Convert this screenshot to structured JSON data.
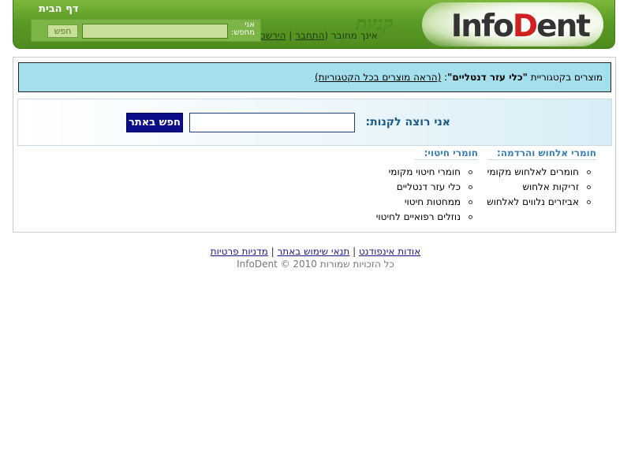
{
  "header": {
    "logo_prefix": "Info",
    "logo_red": "D",
    "logo_suffix": "ent",
    "logo_subtitle": "קניות",
    "home_link": "דף הבית",
    "status_text": "אינך מחובר",
    "login_link": "התחבר",
    "register_link": "הירשם",
    "search": {
      "label": "אני מחפש:",
      "value": "",
      "button": "חפש"
    }
  },
  "category_bar": {
    "prefix": "מוצרים בקטגוריית",
    "category_name": "\"כלי עזר דנטליים\"",
    "separator": ":",
    "all_link": "(הראה מוצרים בכל הקטגוריות)"
  },
  "want": {
    "label": "אני רוצה לקנות:",
    "value": "",
    "button": "חפש באתר"
  },
  "categories": [
    {
      "title": "חומרי אלחוש והרדמה:",
      "items": [
        "חומרים לאלחוש מקומי",
        "זריקות אלחוש",
        "אביזרים נלווים לאלחוש"
      ]
    },
    {
      "title": "חומרי חיטוי:",
      "items": [
        "חומרי חיטוי מקומי",
        "כלי עזר דנטליים",
        "ממחטות חיטוי",
        "נוזלים רפואיים לחיטוי"
      ]
    }
  ],
  "footer": {
    "links": [
      "אודות אינפודנט",
      "תנאי שימוש באתר",
      "מדניות פרטיות"
    ],
    "separator": "|",
    "copyright": "כל הזכויות שמורות InfoDent © 2010"
  },
  "colors": {
    "header_green": "#5a9a26",
    "category_bar_bg": "#a6dfec",
    "search_button_bg": "#0d0d8a",
    "category_title": "#3b7fb5"
  }
}
